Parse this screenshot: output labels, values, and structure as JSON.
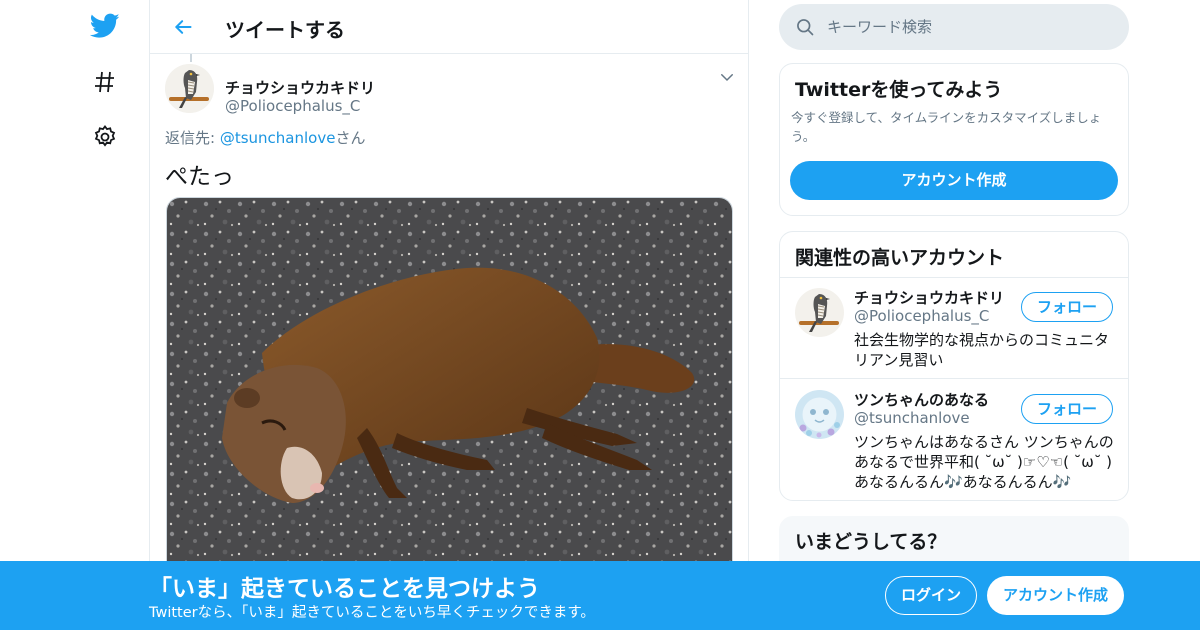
{
  "colors": {
    "accent": "#1da1f2",
    "link": "#1b95e0",
    "secondary_text": "#657786",
    "border": "#e6ecf0"
  },
  "nav": {
    "icons": [
      "twitter-bird-icon",
      "hashtag-icon",
      "gear-icon"
    ]
  },
  "header": {
    "title": "ツイートする",
    "back_icon": "arrow-left-icon"
  },
  "tweet": {
    "author_name": "チョウショウカキドリ",
    "author_handle": "@Poliocephalus_C",
    "reply_prefix": "返信先: ",
    "reply_mention": "@tsunchanlove",
    "reply_suffix": "さん",
    "text": "ぺたっ",
    "menu_icon": "chevron-down-icon"
  },
  "search": {
    "placeholder": "キーワード検索",
    "icon": "search-icon"
  },
  "signup_card": {
    "title": "Twitterを使ってみよう",
    "description": "今すぐ登録して、タイムラインをカスタマイズしましょう。",
    "button": "アカウント作成"
  },
  "related": {
    "title": "関連性の高いアカウント",
    "accounts": [
      {
        "name": "チョウショウカキドリ",
        "handle": "@Poliocephalus_C",
        "bio": "社会生物学的な視点からのコミュニタリアン見習い",
        "follow": "フォロー"
      },
      {
        "name": "ツンちゃんのあなる",
        "handle": "@tsunchanlove",
        "bio": "ツンちゃんはあなるさん ツンちゃんのあなるで世界平和( ˘ω˘ )☞♡☜( ˘ω˘ ) あなるんるん🎶あなるんるん🎶",
        "follow": "フォロー"
      }
    ]
  },
  "trends": {
    "title": "いまどうしてる？"
  },
  "banner": {
    "title": "「いま」起きていることを見つけよう",
    "subtitle": "Twitterなら、「いま」起きていることをいち早くチェックできます。",
    "login": "ログイン",
    "signup": "アカウント作成"
  }
}
